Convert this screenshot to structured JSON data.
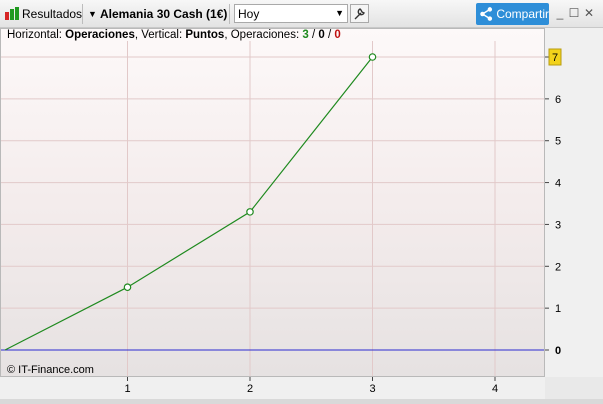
{
  "toolbar": {
    "results_label": "Resultados",
    "instrument": "Alemania 30 Cash (1€)",
    "period": "Hoy",
    "share_label": "Compartir",
    "minimize": "_",
    "maximize": "☐",
    "close": "✕"
  },
  "header": {
    "horizontal_label": "Horizontal:",
    "horizontal_value": "Operaciones",
    "vertical_label": "Vertical:",
    "vertical_value": "Puntos",
    "ops_label": "Operaciones:",
    "ops_winning": "3",
    "ops_neutral": "0",
    "ops_losing": "0"
  },
  "copyright": "© IT-Finance.com",
  "colors": {
    "line": "#1f8a1f",
    "zero_line": "#2b2bd0",
    "share_bg": "#2e8ed8",
    "last_badge": "#f2d21b"
  },
  "chart_data": {
    "type": "line",
    "x": [
      0,
      1,
      2,
      3
    ],
    "y": [
      0,
      1.5,
      3.3,
      7.0
    ],
    "x_ticks": [
      "1",
      "2",
      "3",
      "4"
    ],
    "y_ticks": [
      "0",
      "1",
      "2",
      "3",
      "4",
      "5",
      "6",
      "7"
    ],
    "xlim": [
      0,
      4.4
    ],
    "ylim": [
      0,
      7
    ],
    "last_value_label": "7",
    "grid": true
  }
}
